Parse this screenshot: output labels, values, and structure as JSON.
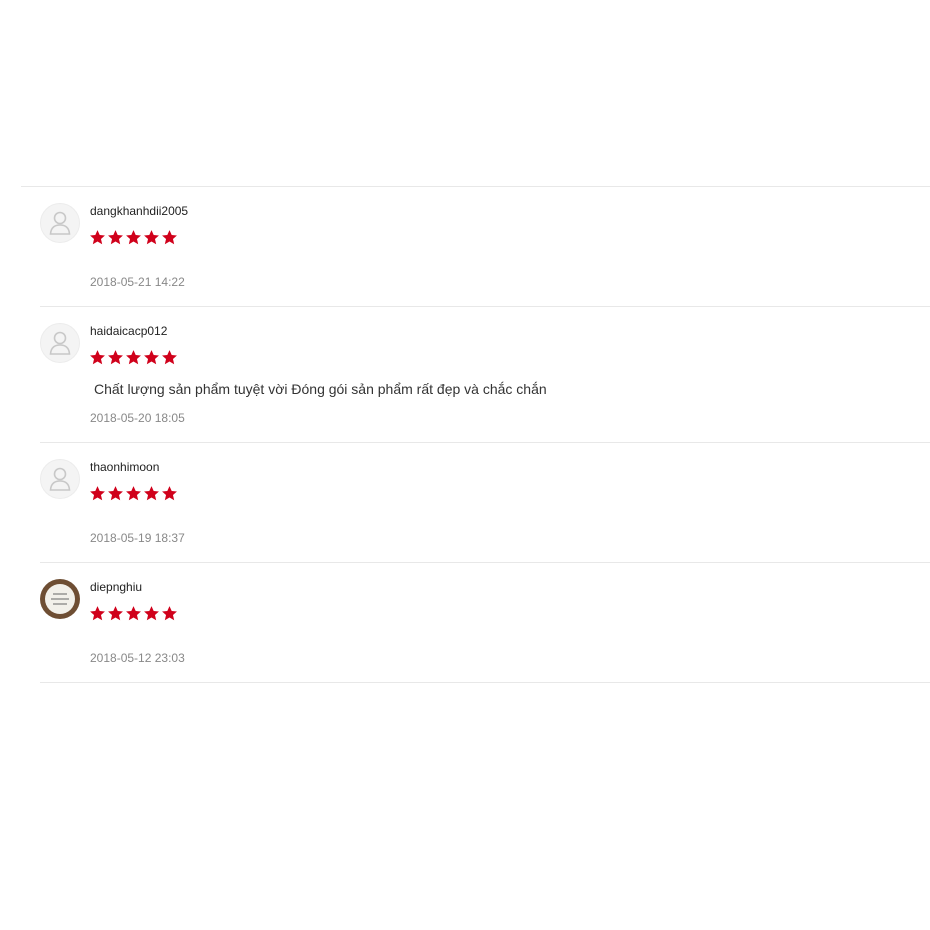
{
  "colors": {
    "star": "#d0011b",
    "divider": "#e8e8e8",
    "timestamp": "#888888"
  },
  "reviews": [
    {
      "username": "dangkhanhdii2005",
      "rating": 5,
      "comment": "",
      "timestamp": "2018-05-21 14:22",
      "avatar": "default-avatar-icon"
    },
    {
      "username": "haidaicacp012",
      "rating": 5,
      "comment": "Chất lượng sản phẩm tuyệt vời Đóng gói sản phẩm rất đẹp và chắc chắn",
      "timestamp": "2018-05-20 18:05",
      "avatar": "default-avatar-icon"
    },
    {
      "username": "thaonhimoon",
      "rating": 5,
      "comment": "",
      "timestamp": "2018-05-19 18:37",
      "avatar": "default-avatar-icon"
    },
    {
      "username": "diepnghiu",
      "rating": 5,
      "comment": "",
      "timestamp": "2018-05-12 23:03",
      "avatar": "photo-avatar"
    }
  ]
}
